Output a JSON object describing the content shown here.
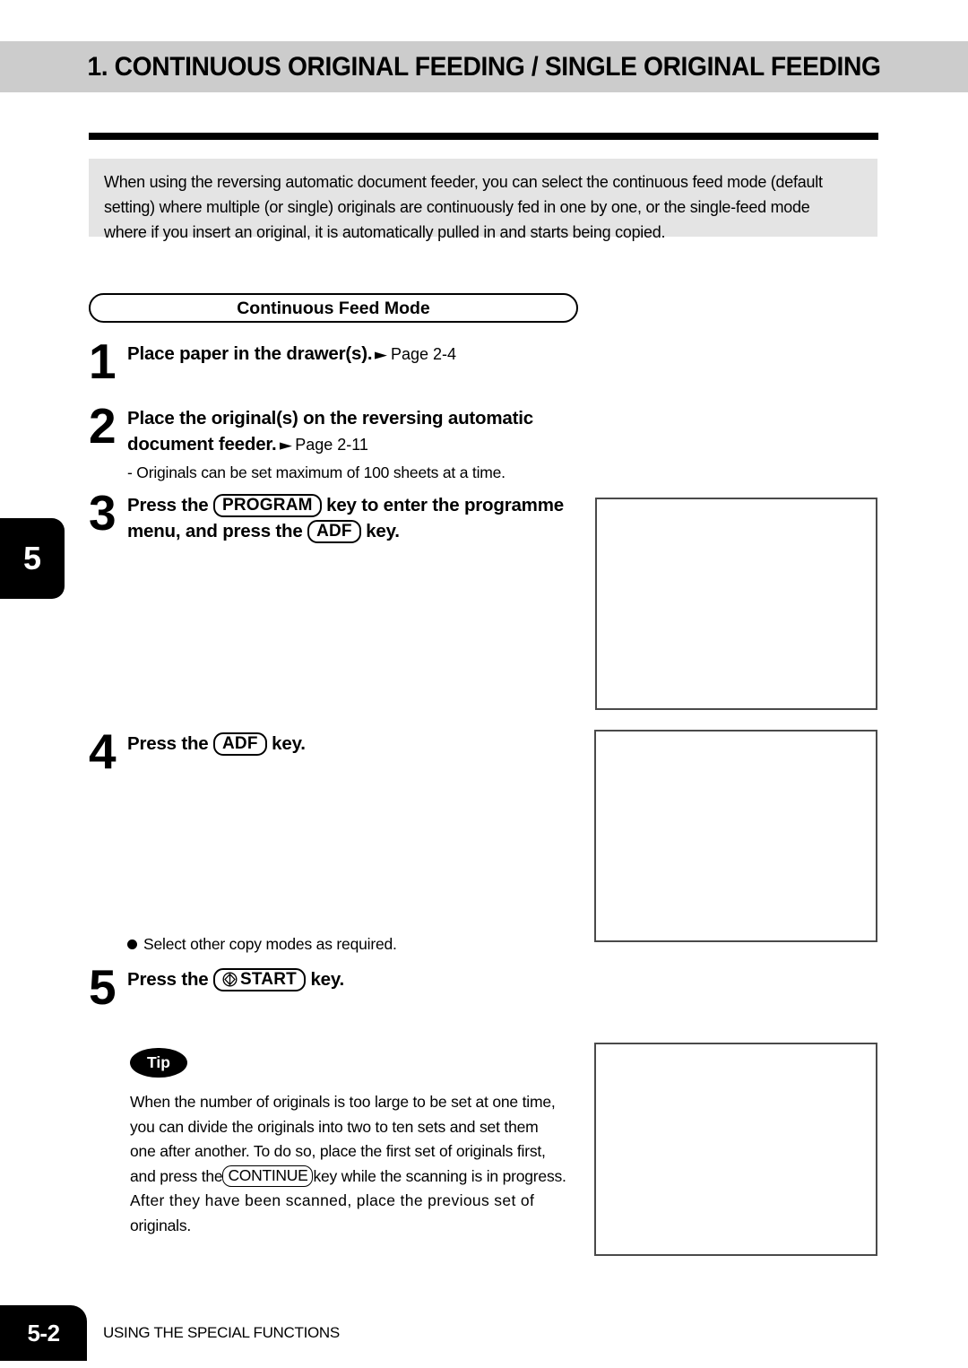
{
  "header": {
    "title": "1. CONTINUOUS ORIGINAL FEEDING / SINGLE ORIGINAL FEEDING"
  },
  "intro": {
    "text": "When using the reversing automatic document feeder, you can select the continuous feed mode (default setting) where multiple (or single) originals are continuously fed in one by one, or the single-feed mode where if you insert an original, it is automatically pulled in and starts being copied."
  },
  "chapter_tab": {
    "number": "5"
  },
  "section": {
    "oval_label": "Continuous Feed Mode"
  },
  "steps": [
    {
      "number": "1",
      "head": "Place paper in the drawer(s).",
      "arrow": "►",
      "pageref": "Page 2-4"
    },
    {
      "number": "2",
      "head_line1": "Place  the  original(s)  on  the  reversing  automatic",
      "head_line2": "document feeder.",
      "arrow": "►",
      "pageref": "Page 2-11",
      "note": "- Originals can be set maximum of 100 sheets at a time."
    },
    {
      "number": "3",
      "head_a": "Press the",
      "key1": "PROGRAM",
      "head_b": "key to enter the programme",
      "head_c": "menu, and press the",
      "key2": "ADF",
      "head_d": "key."
    },
    {
      "number": "4",
      "head_a": "Press the",
      "key1": "ADF",
      "head_b": "key."
    },
    {
      "number": "5",
      "head_a": "Press the",
      "key1": "START",
      "key1_icon": "start-diamond-icon",
      "head_b": "key."
    }
  ],
  "bullet_note": {
    "text": "Select other copy modes as required."
  },
  "tip": {
    "badge": "Tip",
    "line1": "When the number of originals is too large to be set at one time,",
    "line2": "you can divide the originals into two to ten sets and set them",
    "line3": "one after another.  To do so, place the first set of originals first,",
    "line4_a": "and press the",
    "line4_key": "CONTINUE",
    "line4_b": "key while the scanning is in progress.",
    "line5": "After they have been scanned, place the previous set of",
    "line6": "originals."
  },
  "illustrations": [
    {
      "name": "illustration-step3"
    },
    {
      "name": "illustration-step4"
    },
    {
      "name": "illustration-tip"
    }
  ],
  "footer": {
    "page": "5-2",
    "label": "USING THE SPECIAL FUNCTIONS"
  },
  "colors": {
    "header_band": "#cccccc",
    "intro_box": "#e4e4e4",
    "tab_black": "#000000",
    "illus_border": "#4a4a4a"
  }
}
